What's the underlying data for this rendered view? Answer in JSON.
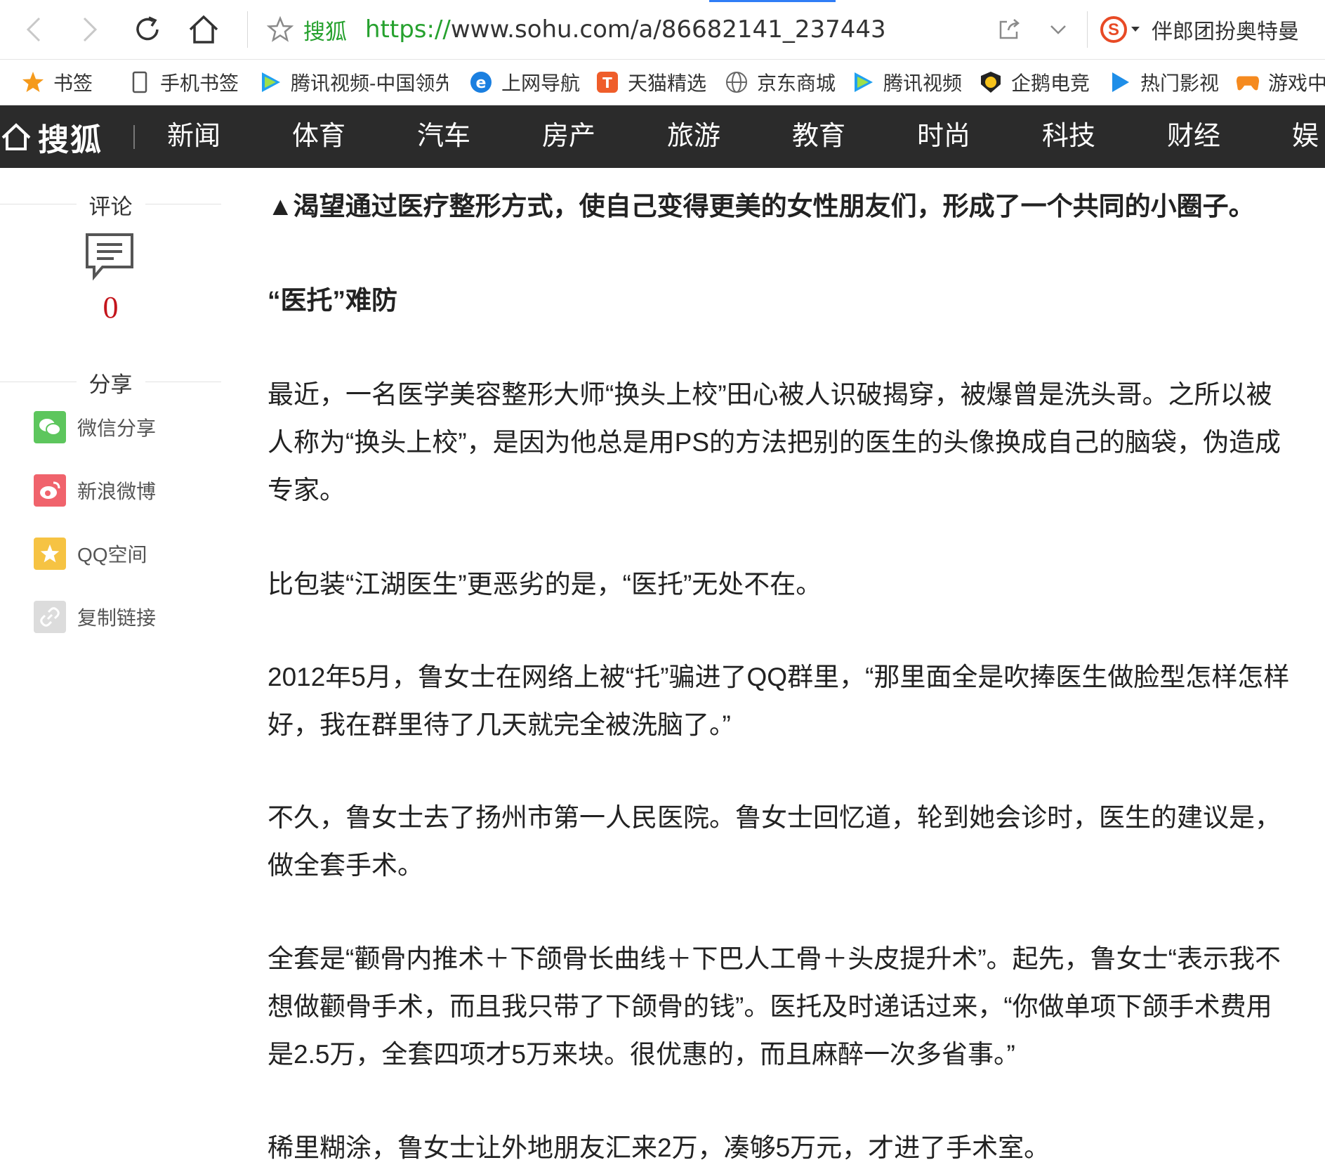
{
  "browser": {
    "site_name": "搜狐",
    "url_scheme": "https://",
    "url_rest": "www.sohu.com/a/86682141_237443",
    "search_suggestion": "伴郎团扮奥特曼"
  },
  "bookmarks": [
    {
      "icon": "star-icon",
      "label": "书签"
    },
    {
      "icon": "phone-icon",
      "label": "手机书签"
    },
    {
      "icon": "tencent-video-icon",
      "label": "腾讯视频-中国领先"
    },
    {
      "icon": "ie-icon",
      "label": "上网导航"
    },
    {
      "icon": "tmall-icon",
      "label": "天猫精选"
    },
    {
      "icon": "globe-icon",
      "label": "京东商城"
    },
    {
      "icon": "tencent-video-icon",
      "label": "腾讯视频"
    },
    {
      "icon": "penguin-esports-icon",
      "label": "企鹅电竞"
    },
    {
      "icon": "play-icon",
      "label": "热门影视"
    },
    {
      "icon": "gamepad-icon",
      "label": "游戏中"
    }
  ],
  "site_nav": {
    "logo": "搜狐",
    "items": [
      "新闻",
      "体育",
      "汽车",
      "房产",
      "旅游",
      "教育",
      "时尚",
      "科技",
      "财经",
      "娱乐"
    ]
  },
  "sidebar": {
    "comment_title": "评论",
    "comment_count": "0",
    "share_title": "分享",
    "share_items": [
      {
        "label": "微信分享",
        "icon": "wechat-icon",
        "color": "#5dc65d"
      },
      {
        "label": "新浪微博",
        "icon": "weibo-icon",
        "color": "#f0636c"
      },
      {
        "label": "QQ空间",
        "icon": "qzone-star-icon",
        "color": "#f6c343"
      },
      {
        "label": "复制链接",
        "icon": "link-icon",
        "color": "#dcdcdc"
      }
    ]
  },
  "article": {
    "paragraphs": [
      "▲渴望通过医疗整形方式，使自己变得更美的女性朋友们，形成了一个共同的小圈子。",
      "“医托”难防",
      "最近，一名医学美容整形大师“换头上校”田心被人识破揭穿，被爆曾是洗头哥。之所以被人称为“换头上校”，是因为他总是用PS的方法把别的医生的头像换成自己的脑袋，伪造成专家。",
      "比包装“江湖医生”更恶劣的是，“医托”无处不在。",
      "2012年5月，鲁女士在网络上被“托”骗进了QQ群里，“那里面全是吹捧医生做脸型怎样怎样好，我在群里待了几天就完全被洗脑了。”",
      "不久，鲁女士去了扬州市第一人民医院。鲁女士回忆道，轮到她会诊时，医生的建议是，做全套手术。",
      "全套是“颧骨内推术＋下颌骨长曲线＋下巴人工骨＋头皮提升术”。起先，鲁女士“表示我不想做颧骨手术，而且我只带了下颌骨的钱”。医托及时递话过来，“你做单项下颌手术费用是2.5万，全套四项才5万来块。很优惠的，而且麻醉一次多省事。”",
      "稀里糊涂，鲁女士让外地朋友汇来2万，凑够5万元，才进了手术室。"
    ]
  }
}
